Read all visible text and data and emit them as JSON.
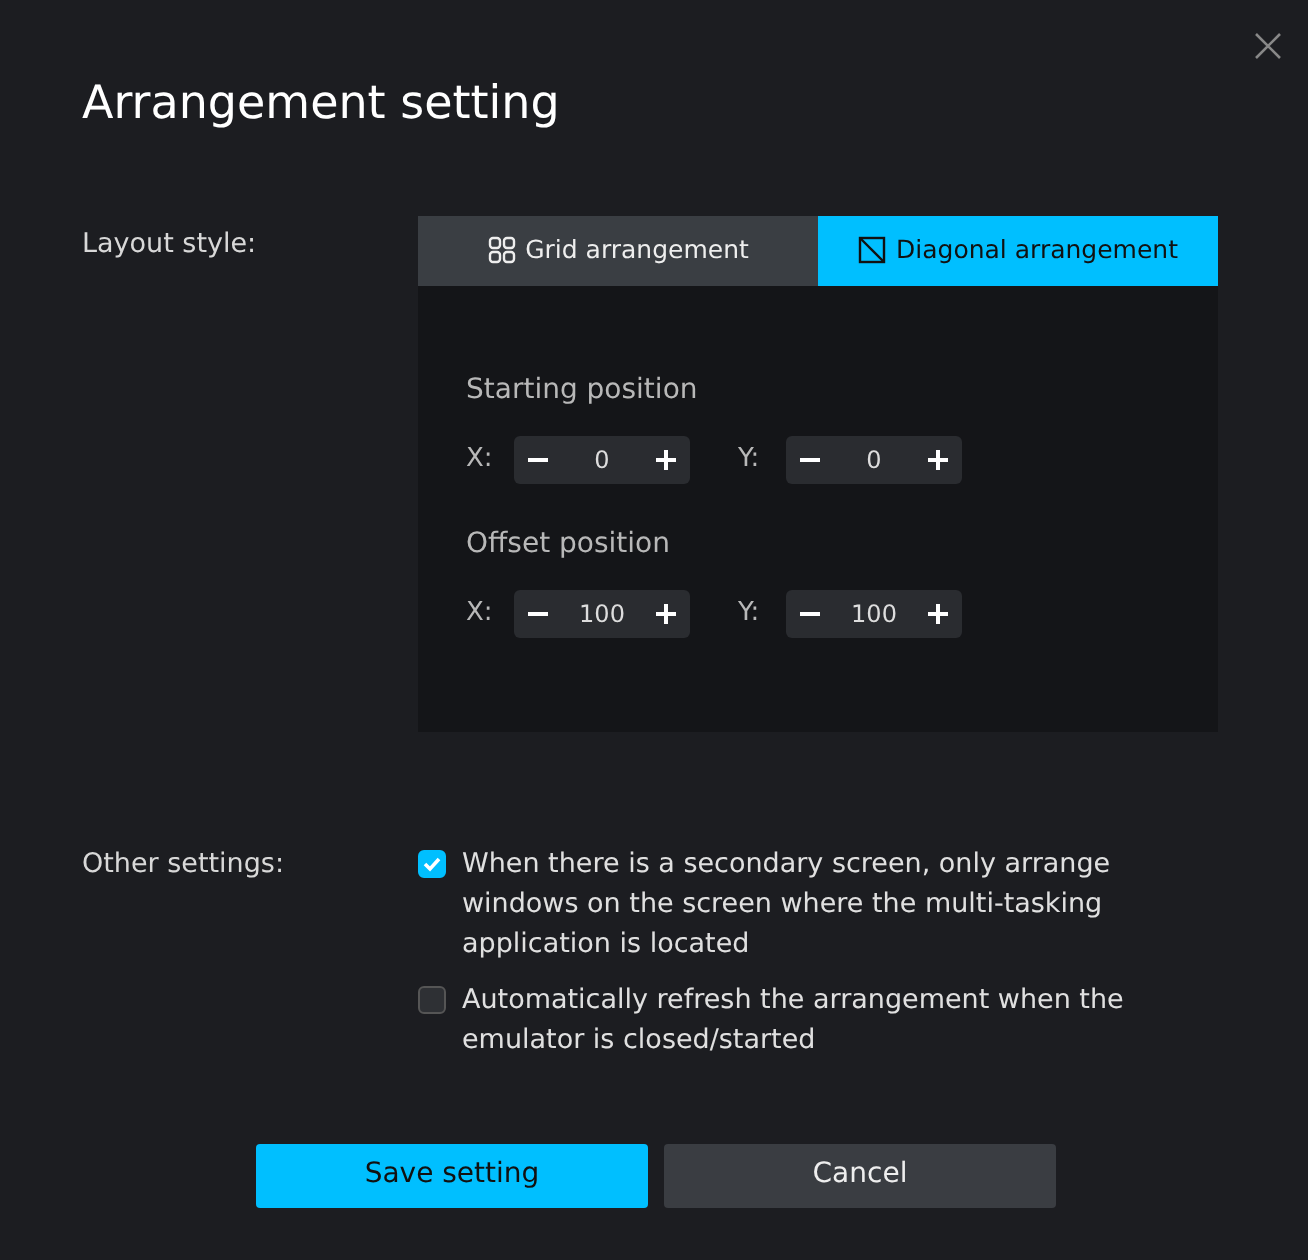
{
  "window": {
    "title": "Arrangement setting"
  },
  "layout_style": {
    "label": "Layout style:",
    "tabs": [
      {
        "label": "Grid arrangement",
        "kind": "grid",
        "selected": false
      },
      {
        "label": "Diagonal arrangement",
        "kind": "diagonal",
        "selected": true
      }
    ],
    "groups": [
      {
        "title": "Starting position",
        "fields": [
          {
            "axis": "X:",
            "value": "0"
          },
          {
            "axis": "Y:",
            "value": "0"
          }
        ]
      },
      {
        "title": "Offset position",
        "fields": [
          {
            "axis": "X:",
            "value": "100"
          },
          {
            "axis": "Y:",
            "value": "100"
          }
        ]
      }
    ]
  },
  "other_settings": {
    "label": "Other settings:",
    "options": [
      {
        "text": "When there is a secondary screen, only arrange windows on the screen where the multi-tasking application is located",
        "checked": true
      },
      {
        "text": "Automatically refresh the arrangement when the emulator is closed/started",
        "checked": false
      }
    ]
  },
  "buttons": [
    {
      "label": "Save setting",
      "kind": "primary"
    },
    {
      "label": "Cancel",
      "kind": "secondary"
    }
  ]
}
